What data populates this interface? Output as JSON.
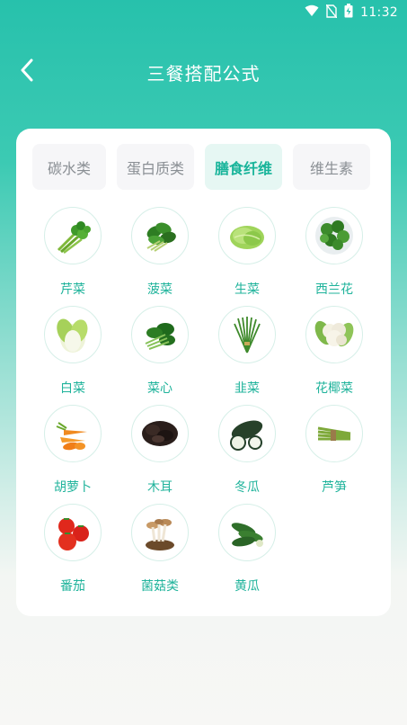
{
  "status_bar": {
    "time": "11:32",
    "icons": [
      "wifi-icon",
      "no-sim-icon",
      "battery-charging-icon"
    ]
  },
  "header": {
    "title": "三餐搭配公式",
    "back_icon": "chevron-left-icon"
  },
  "tabs": [
    {
      "label": "碳水类",
      "active": false
    },
    {
      "label": "蛋白质类",
      "active": false
    },
    {
      "label": "膳食纤维",
      "active": true
    },
    {
      "label": "维生素",
      "active": false
    }
  ],
  "items": [
    {
      "label": "芹菜",
      "icon": "celery-image"
    },
    {
      "label": "菠菜",
      "icon": "spinach-image"
    },
    {
      "label": "生菜",
      "icon": "lettuce-image"
    },
    {
      "label": "西兰花",
      "icon": "broccoli-image"
    },
    {
      "label": "白菜",
      "icon": "chinese-cabbage-image"
    },
    {
      "label": "菜心",
      "icon": "choy-sum-image"
    },
    {
      "label": "韭菜",
      "icon": "chives-image"
    },
    {
      "label": "花椰菜",
      "icon": "cauliflower-image"
    },
    {
      "label": "胡萝卜",
      "icon": "carrot-image"
    },
    {
      "label": "木耳",
      "icon": "wood-ear-image"
    },
    {
      "label": "冬瓜",
      "icon": "winter-melon-image"
    },
    {
      "label": "芦笋",
      "icon": "asparagus-image"
    },
    {
      "label": "番茄",
      "icon": "tomato-image"
    },
    {
      "label": "菌菇类",
      "icon": "mushroom-image"
    },
    {
      "label": "黄瓜",
      "icon": "cucumber-image"
    }
  ],
  "colors": {
    "accent": "#1fb39b",
    "header_bg": "#27c1ac",
    "tab_active_bg": "#e6f7f3",
    "tab_bg": "#f6f6f8"
  }
}
